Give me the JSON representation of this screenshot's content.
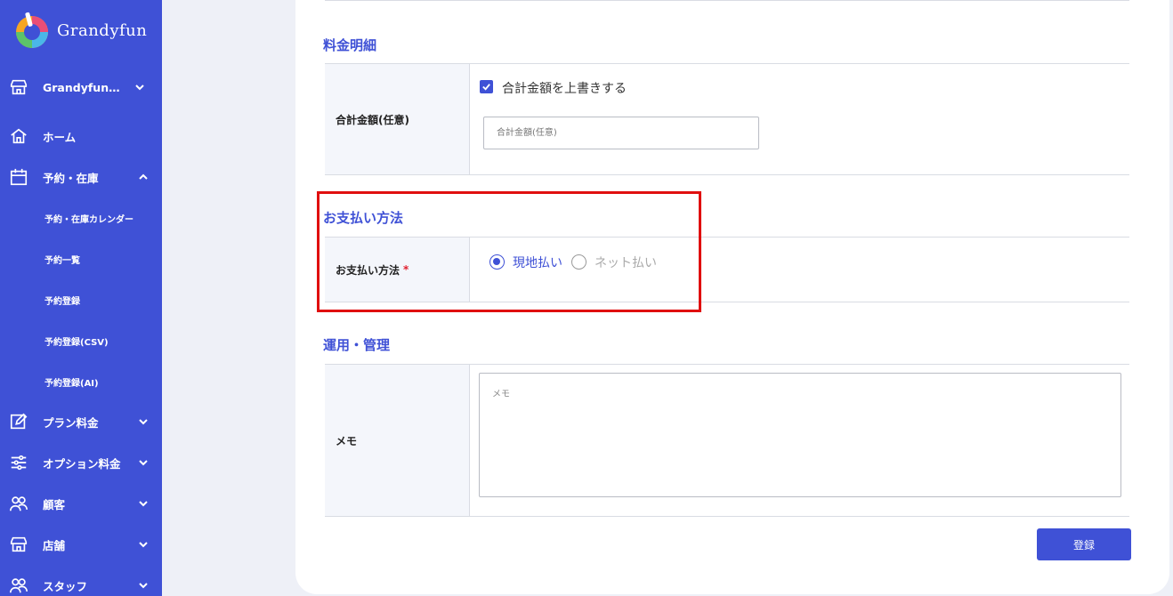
{
  "app": {
    "brand": "Grandyfun"
  },
  "sidebar": {
    "store_selector": "Grandyfun…",
    "items": [
      {
        "label": "ホーム",
        "icon": "home-icon"
      },
      {
        "label": "予約・在庫",
        "icon": "calendar-icon",
        "expanded": true,
        "children": [
          "予約・在庫カレンダー",
          "予約一覧",
          "予約登録",
          "予約登録(CSV)",
          "予約登録(AI)"
        ]
      },
      {
        "label": "プラン料金",
        "icon": "edit-icon"
      },
      {
        "label": "オプション料金",
        "icon": "sliders-icon"
      },
      {
        "label": "顧客",
        "icon": "users-icon"
      },
      {
        "label": "店舗",
        "icon": "store-icon"
      },
      {
        "label": "スタッフ",
        "icon": "staff-icon"
      }
    ]
  },
  "pricing": {
    "section_title": "料金明細",
    "total_label": "合計金額(任意)",
    "override_label": "合計金額を上書きする",
    "override_checked": true,
    "total_placeholder": "合計金額(任意)"
  },
  "payment": {
    "section_title": "お支払い方法",
    "field_label": "お支払い方法",
    "required_mark": "*",
    "options": [
      "現地払い",
      "ネット払い"
    ],
    "selected": "現地払い"
  },
  "operations": {
    "section_title": "運用・管理",
    "memo_label": "メモ",
    "memo_placeholder": "メモ"
  },
  "actions": {
    "submit_label": "登録"
  },
  "colors": {
    "primary": "#3f51d6",
    "highlight": "#e00f0f",
    "required": "#e0202f"
  }
}
